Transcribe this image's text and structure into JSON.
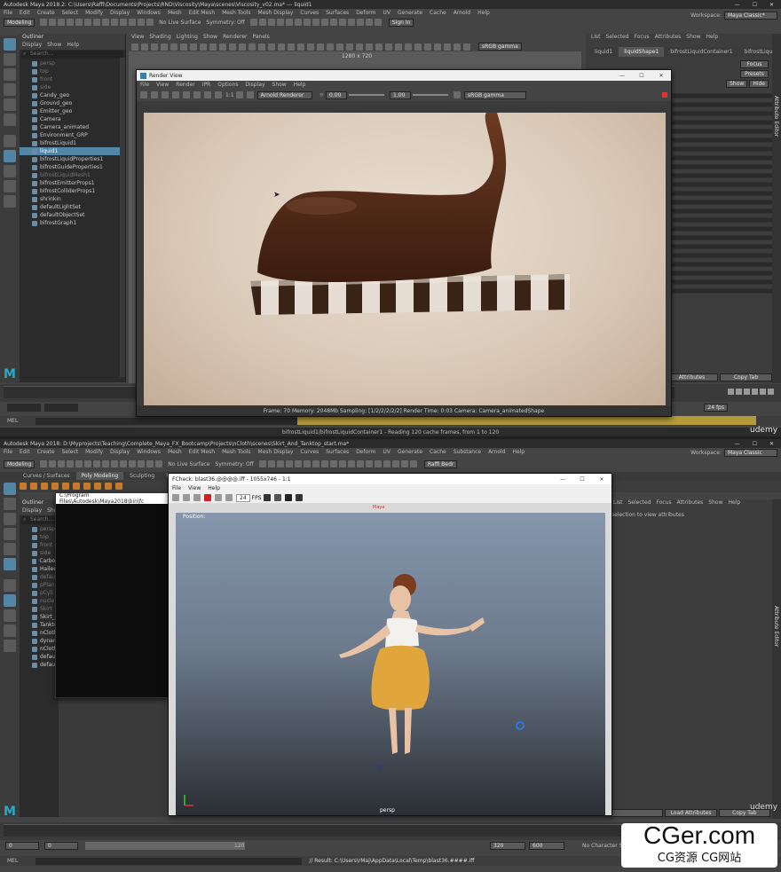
{
  "top": {
    "title": "Autodesk Maya 2018.2: C:\\Users\\Raffi\\Documents\\Projects\\RND\\Viscosity\\Maya\\scenes\\Viscosity_v02.ma* --- liquid1",
    "menu": [
      "File",
      "Edit",
      "Create",
      "Select",
      "Modify",
      "Display",
      "Windows",
      "Mesh",
      "Edit Mesh",
      "Mesh Tools",
      "Mesh Display",
      "Curves",
      "Surfaces",
      "Deform",
      "UV",
      "Generate",
      "Cache",
      "Arnold",
      "Help"
    ],
    "workspace_label": "Workspace:",
    "workspace_value": "Maya Classic*",
    "mode": "Modeling",
    "no_live_surface": "No Live Surface",
    "symmetry": "Symmetry: Off",
    "sign_in": "Sign In",
    "outliner": {
      "title": "Outliner",
      "menu": [
        "Display",
        "Show",
        "Help"
      ],
      "search_placeholder": "Search...",
      "items": [
        {
          "label": "persp",
          "state": "dim"
        },
        {
          "label": "top",
          "state": "dim"
        },
        {
          "label": "front",
          "state": "dim"
        },
        {
          "label": "side",
          "state": "dim"
        },
        {
          "label": "Candy_geo",
          "state": ""
        },
        {
          "label": "Ground_geo",
          "state": ""
        },
        {
          "label": "Emitter_geo",
          "state": ""
        },
        {
          "label": "Camera",
          "state": ""
        },
        {
          "label": "Camera_animated",
          "state": ""
        },
        {
          "label": "Environment_GRP",
          "state": ""
        },
        {
          "label": "bifrostLiquid1",
          "state": ""
        },
        {
          "label": "liquid1",
          "state": "hl"
        },
        {
          "label": "bifrostLiquidProperties1",
          "state": ""
        },
        {
          "label": "bifrostGuideProperties1",
          "state": ""
        },
        {
          "label": "bifrostLiquidMesh1",
          "state": "dim"
        },
        {
          "label": "bifrostEmitterProps1",
          "state": ""
        },
        {
          "label": "bifrostColliderProps1",
          "state": ""
        },
        {
          "label": "shrinkin",
          "state": ""
        },
        {
          "label": "defaultLightSet",
          "state": ""
        },
        {
          "label": "defaultObjectSet",
          "state": ""
        },
        {
          "label": "bifrostGraph1",
          "state": ""
        }
      ]
    },
    "viewport_menu": [
      "View",
      "Shading",
      "Lighting",
      "Show",
      "Renderer",
      "Panels"
    ],
    "hud": {
      "resolution": "1280 x 720"
    },
    "right_menu": [
      "List",
      "Selected",
      "Focus",
      "Attributes",
      "Show",
      "Help"
    ],
    "ae_tabs": [
      "liquid1",
      "liquidShape1",
      "bifrostLiquidContainer1",
      "bifrostLiquidPropert1"
    ],
    "ae_buttons": [
      "Focus",
      "Presets",
      "Show",
      "Hide"
    ],
    "ae_side_label": "Attribute Editor",
    "ae_footer": [
      "Attributes",
      "Copy Tab"
    ],
    "fps": "24 fps",
    "status_line": "bifrostLiquid1/bifrostLiquidContainer1 - Reading 120 cache frames, from 1 to 120",
    "mel": "MEL",
    "render_view": {
      "title": "Render View",
      "menu": [
        "File",
        "View",
        "Render",
        "IPR",
        "Options",
        "Display",
        "Show",
        "Help"
      ],
      "renderer": "Arnold Renderer",
      "gamma": "sRGB gamma",
      "exposure": "0.00",
      "gamma_val": "1.00",
      "ratio": "1:1",
      "status": "Frame: 70    Memory: 2048Mb    Sampling: [1/2/2/2/2/2]    Render Time: 0:03    Camera: Camera_animatedShape"
    }
  },
  "bottom": {
    "title": "Autodesk Maya 2018: D:\\Myprojects\\Teaching\\Complete_Maya_FX_Bootcamp\\Projects\\nCloth\\scenes\\Skirt_And_Tanktop_start.ma*",
    "menu": [
      "File",
      "Edit",
      "Create",
      "Select",
      "Modify",
      "Display",
      "Windows",
      "Mesh",
      "Edit Mesh",
      "Mesh Tools",
      "Mesh Display",
      "Curves",
      "Surfaces",
      "Deform",
      "UV",
      "Generate",
      "Cache",
      "Substance",
      "Arnold",
      "Help"
    ],
    "workspace_label": "Workspace:",
    "workspace_value": "Maya Classic",
    "mode": "Modeling",
    "user": "Raffi Bedr",
    "no_live_surface": "No Live Surface",
    "symmetry": "Symmetry: Off",
    "shelf_tabs": [
      "Curves / Surfaces",
      "Poly Modeling",
      "Sculpting",
      "Rigging"
    ],
    "outliner": {
      "title": "Outliner",
      "menu": [
        "Display",
        "Show"
      ],
      "search_placeholder": "Search...",
      "items": [
        {
          "label": "persp",
          "state": "dim"
        },
        {
          "label": "top",
          "state": "dim"
        },
        {
          "label": "front",
          "state": "dim"
        },
        {
          "label": "side",
          "state": "dim"
        },
        {
          "label": "Carbon",
          "state": ""
        },
        {
          "label": "Hailee",
          "state": ""
        },
        {
          "label": "defau",
          "state": "dim"
        },
        {
          "label": "pPlan",
          "state": "dim"
        },
        {
          "label": "pCyli",
          "state": "dim"
        },
        {
          "label": "nucle",
          "state": "dim"
        },
        {
          "label": "Skirt",
          "state": "dim"
        },
        {
          "label": "Skirt_s",
          "state": ""
        },
        {
          "label": "Tankto",
          "state": ""
        },
        {
          "label": "nCloth",
          "state": ""
        },
        {
          "label": "dynam",
          "state": ""
        },
        {
          "label": "nCloth",
          "state": ""
        },
        {
          "label": "defaul",
          "state": ""
        },
        {
          "label": "defaul",
          "state": ""
        }
      ]
    },
    "cmd_window": {
      "title": "C:\\Program Files\\Autodesk\\Maya2018\\bin\\fc"
    },
    "right_menu": [
      "List",
      "Selected",
      "Focus",
      "Attributes",
      "Show",
      "Help"
    ],
    "ae_hint": "selection to view attributes",
    "ae_footer": [
      "Load Attributes",
      "Copy Tab"
    ],
    "ae_side_label": "Attribute Editor",
    "fcheck": {
      "title": "FCheck: blast36.@@@@.iff - 1055x746 - 1:1",
      "menu": [
        "File",
        "View",
        "Help"
      ],
      "fps_value": "24",
      "fps_label": "FPS",
      "frame_hud": "Position:",
      "camera": "persp",
      "top_label": "Maya"
    },
    "help_line": "No help available for this tool",
    "result": "// Result: C:\\Users\\rMaj\\AppData\\Local\\Temp\\blast36.####.iff",
    "no_character": "No Character Set",
    "range": {
      "start": "0",
      "start2": "0",
      "end": "120",
      "end2": "320",
      "end3": "600"
    },
    "mel": "MEL"
  },
  "watermark": {
    "text": "CGer.com",
    "sub": "CG资源  CG网站"
  },
  "udemy": "udemy",
  "colors": {
    "maya_bg": "#444444",
    "highlight": "#5285a6",
    "chocolate": "#4a2414",
    "skirt": "#e0a53b"
  }
}
